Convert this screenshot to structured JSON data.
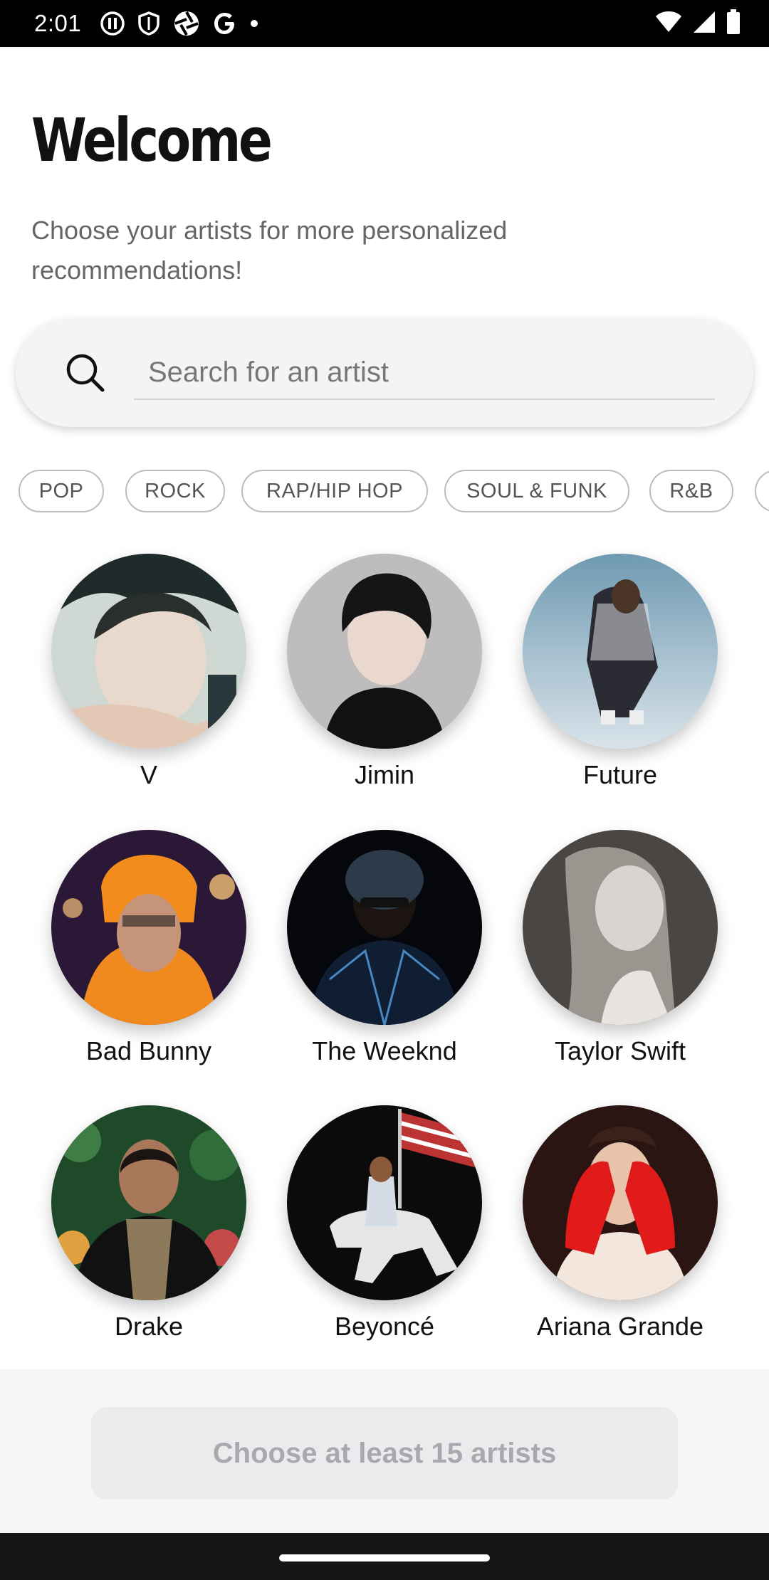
{
  "status_bar": {
    "time": "2:01"
  },
  "header": {
    "title": "Welcome",
    "subtitle": "Choose your artists for more personalized recommendations!"
  },
  "search": {
    "placeholder": "Search for an artist",
    "icon": "search-icon"
  },
  "genres": [
    "POP",
    "ROCK",
    "RAP/HIP HOP",
    "SOUL & FUNK",
    "R&B"
  ],
  "artists": [
    {
      "name": "V"
    },
    {
      "name": "Jimin"
    },
    {
      "name": "Future"
    },
    {
      "name": "Bad Bunny"
    },
    {
      "name": "The Weeknd"
    },
    {
      "name": "Taylor Swift"
    },
    {
      "name": "Drake"
    },
    {
      "name": "Beyoncé"
    },
    {
      "name": "Ariana Grande"
    }
  ],
  "footer": {
    "button_label": "Choose at least 15 artists",
    "button_enabled": false
  },
  "colors": {
    "button_bg": "#ebebee",
    "button_text": "#a9a9ad",
    "chip_border": "#bdbdbd"
  }
}
